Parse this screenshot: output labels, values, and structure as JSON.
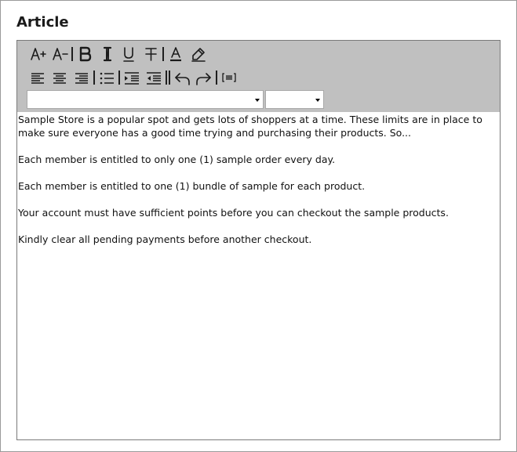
{
  "heading": "Article",
  "toolbar": {
    "row1": [
      {
        "name": "increase-font-size-icon",
        "kind": "btn"
      },
      {
        "name": "decrease-font-size-icon",
        "kind": "btn"
      },
      {
        "kind": "sep"
      },
      {
        "name": "bold-icon",
        "kind": "btn"
      },
      {
        "name": "italic-icon",
        "kind": "btn"
      },
      {
        "name": "underline-icon",
        "kind": "btn"
      },
      {
        "name": "strikethrough-icon",
        "kind": "btn"
      },
      {
        "kind": "sep"
      },
      {
        "name": "text-color-icon",
        "kind": "btn"
      },
      {
        "name": "highlight-icon",
        "kind": "btn"
      }
    ],
    "row2": [
      {
        "name": "align-left-icon",
        "kind": "btn"
      },
      {
        "name": "align-center-icon",
        "kind": "btn"
      },
      {
        "name": "align-right-icon",
        "kind": "btn"
      },
      {
        "kind": "sep"
      },
      {
        "name": "bullet-list-icon",
        "kind": "btn"
      },
      {
        "kind": "sep"
      },
      {
        "name": "indent-icon",
        "kind": "btn"
      },
      {
        "name": "outdent-icon",
        "kind": "btn"
      },
      {
        "kind": "sep"
      },
      {
        "kind": "sep"
      },
      {
        "name": "undo-icon",
        "kind": "btn"
      },
      {
        "name": "redo-icon",
        "kind": "btn"
      },
      {
        "kind": "sep"
      },
      {
        "name": "html-source-icon",
        "kind": "btn"
      }
    ],
    "font_select": {
      "value": ""
    },
    "size_select": {
      "value": ""
    }
  },
  "content": {
    "paragraphs": [
      "Sample Store is a popular spot and gets lots of shoppers at a time. These limits are in place to make sure everyone has a good time trying and purchasing their products. So...",
      "Each member is entitled to only one (1) sample order every day.",
      "Each member is entitled to one (1) bundle of sample for each product.",
      "Your account must have sufficient points before you can checkout the sample products.",
      "Kindly clear all pending payments before another checkout."
    ]
  }
}
